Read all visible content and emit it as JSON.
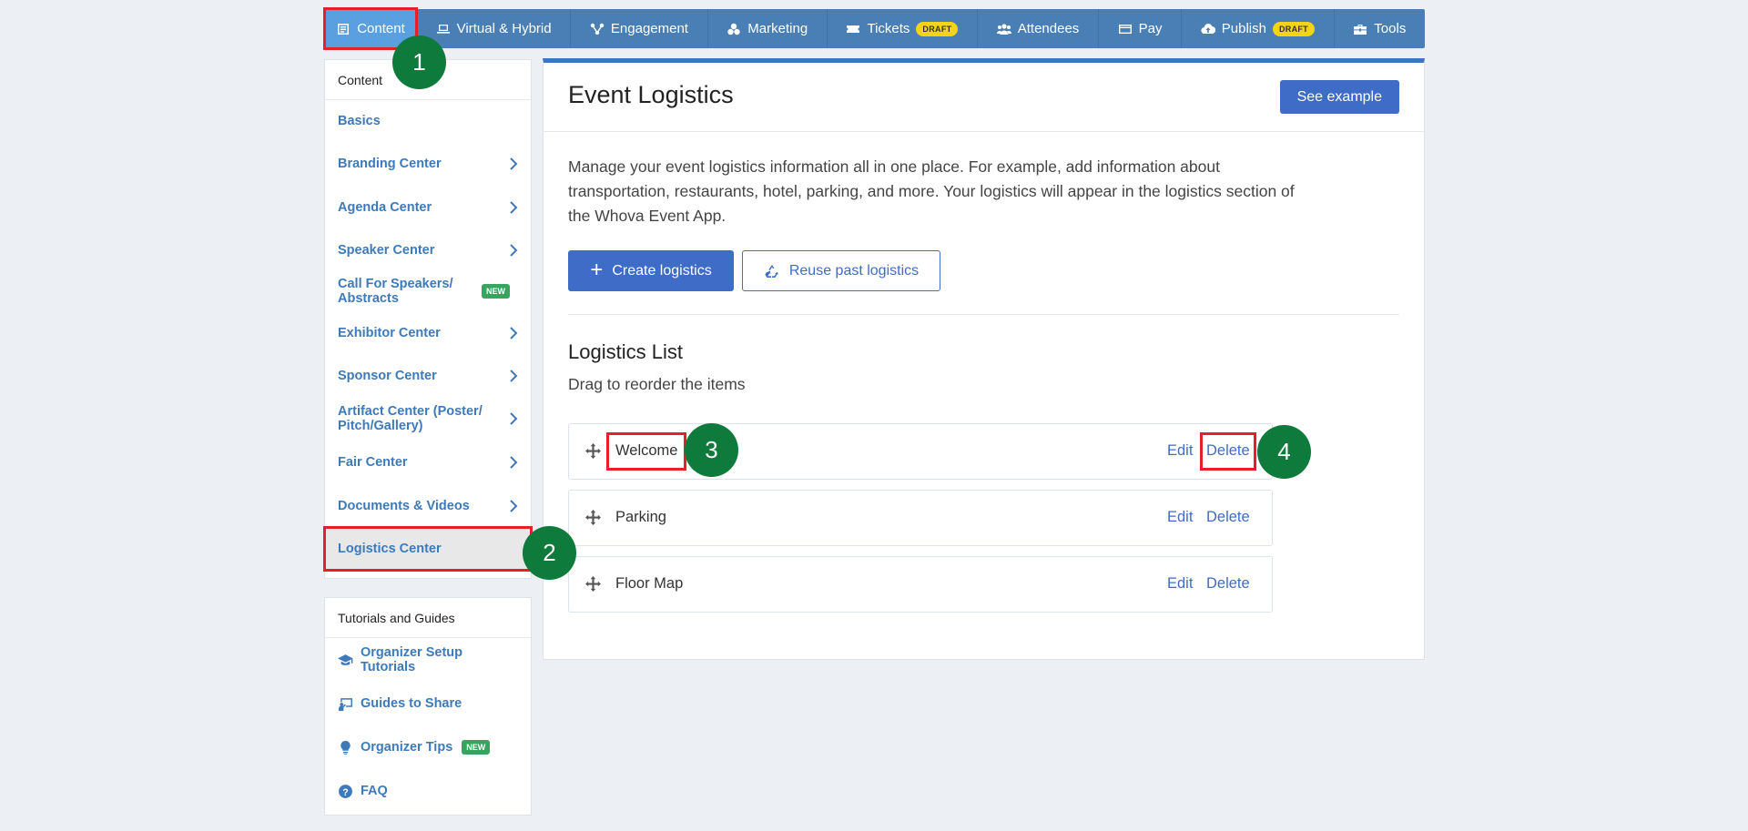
{
  "topnav": {
    "items": [
      {
        "label": "Content",
        "icon": "content-icon"
      },
      {
        "label": "Virtual & Hybrid",
        "icon": "laptop-icon"
      },
      {
        "label": "Engagement",
        "icon": "engagement-icon"
      },
      {
        "label": "Marketing",
        "icon": "marketing-icon"
      },
      {
        "label": "Tickets",
        "icon": "ticket-icon",
        "badge": "DRAFT"
      },
      {
        "label": "Attendees",
        "icon": "attendees-icon"
      },
      {
        "label": "Pay",
        "icon": "card-icon"
      },
      {
        "label": "Publish",
        "icon": "cloud-upload-icon",
        "badge": "DRAFT"
      },
      {
        "label": "Tools",
        "icon": "toolbox-icon"
      }
    ]
  },
  "sidebar": {
    "heading": "Content",
    "items": [
      {
        "label": "Basics"
      },
      {
        "label": "Branding Center"
      },
      {
        "label": "Agenda Center"
      },
      {
        "label": "Speaker Center"
      },
      {
        "label": "Call For Speakers/ Abstracts",
        "badge": "NEW"
      },
      {
        "label": "Exhibitor Center"
      },
      {
        "label": "Sponsor Center"
      },
      {
        "label": "Artifact Center (Poster/ Pitch/Gallery)"
      },
      {
        "label": "Fair Center"
      },
      {
        "label": "Documents & Videos"
      },
      {
        "label": "Logistics Center"
      }
    ]
  },
  "guides": {
    "heading": "Tutorials and Guides",
    "items": [
      {
        "label": "Organizer Setup Tutorials",
        "icon": "graduation-cap-icon"
      },
      {
        "label": "Guides to Share",
        "icon": "presentation-icon"
      },
      {
        "label": "Organizer Tips",
        "icon": "lightbulb-icon",
        "badge": "NEW"
      },
      {
        "label": "FAQ",
        "icon": "question-circle-icon"
      }
    ]
  },
  "main": {
    "title": "Event Logistics",
    "see_example": "See example",
    "description": "Manage your event logistics information all in one place. For example, add information about transportation, restaurants, hotel, parking, and more. Your logistics will appear in the logistics section of the Whova Event App.",
    "create_label": "Create logistics",
    "reuse_label": "Reuse past logistics",
    "list_title": "Logistics List",
    "list_subtitle": "Drag to reorder the items",
    "edit_label": "Edit",
    "delete_label": "Delete",
    "rows": [
      {
        "name": "Welcome"
      },
      {
        "name": "Parking"
      },
      {
        "name": "Floor Map"
      }
    ]
  },
  "markers": [
    "1",
    "2",
    "3",
    "4"
  ],
  "colors": {
    "nav_bg": "#4a7fb5",
    "nav_active": "#5aa0e0",
    "accent": "#3f6cc7",
    "link": "#3d7abb",
    "highlight": "#e5202a",
    "marker": "#0e7a3c",
    "draft_badge": "#f5d315",
    "new_badge": "#37a560"
  }
}
